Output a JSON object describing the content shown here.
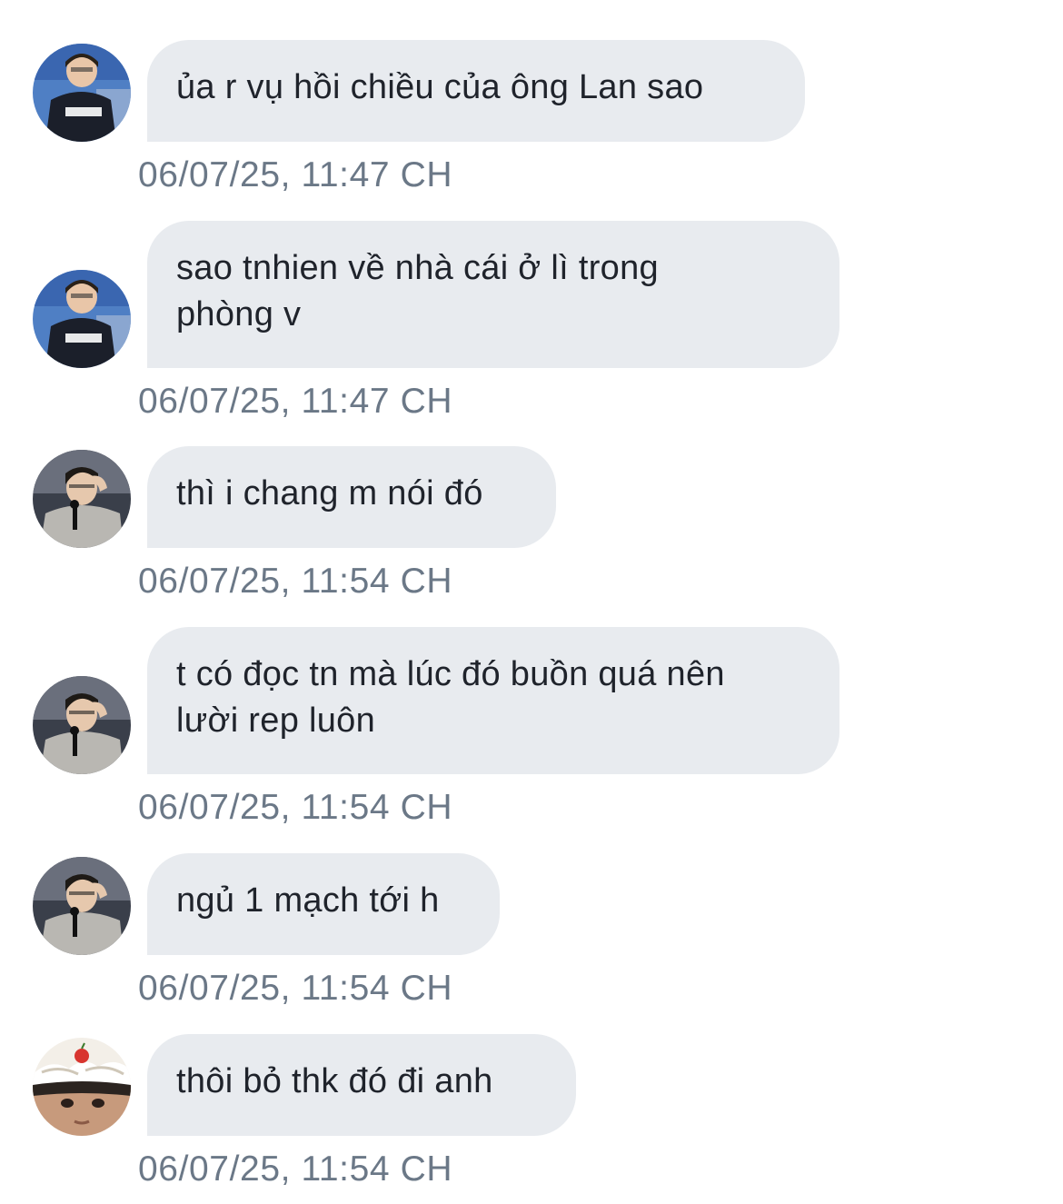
{
  "messages": [
    {
      "sender_avatar": "avatar-player-jersey",
      "text": "ủa r vụ hồi chiều của ông Lan sao",
      "time": "06/07/25, 11:47 CH"
    },
    {
      "sender_avatar": "avatar-player-jersey",
      "text": "sao tnhien về nhà cái ở lì trong\nphòng v",
      "time": "06/07/25, 11:47 CH"
    },
    {
      "sender_avatar": "avatar-person-microphone",
      "text": "thì i chang m nói đó",
      "time": "06/07/25, 11:54 CH"
    },
    {
      "sender_avatar": "avatar-person-microphone",
      "text": "t có đọc tn mà lúc đó buồn quá nên\nlười rep luôn",
      "time": "06/07/25, 11:54 CH"
    },
    {
      "sender_avatar": "avatar-person-microphone",
      "text": "ngủ 1 mạch tới h",
      "time": "06/07/25, 11:54 CH"
    },
    {
      "sender_avatar": "avatar-face-cake",
      "text": "thôi bỏ thk đó đi anh",
      "time": "06/07/25, 11:54 CH"
    }
  ],
  "colors": {
    "bubble_bg": "#e8ebef",
    "bubble_text": "#1f232b",
    "timestamp": "#6b7887",
    "background": "#ffffff"
  }
}
